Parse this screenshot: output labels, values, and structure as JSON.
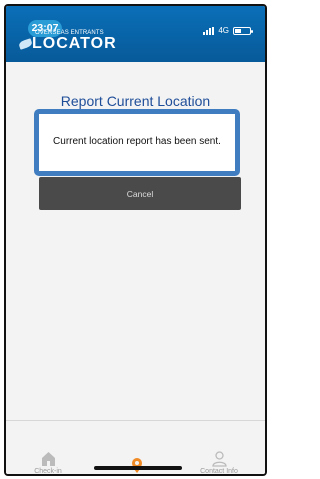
{
  "status_bar": {
    "time": "23:07",
    "network": "4G"
  },
  "app": {
    "logo_top": "OVERSEAS ENTRANTS",
    "logo_bottom": "LOCATOR"
  },
  "page": {
    "title": "Report Current Location"
  },
  "dialog": {
    "message": "Current location report has been sent.",
    "cancel_label": "Cancel"
  },
  "tabs": [
    {
      "label": "Check-in",
      "icon": "home-icon"
    },
    {
      "label": "",
      "icon": "location-pin-icon"
    },
    {
      "label": "Contact Info",
      "icon": "person-icon"
    }
  ],
  "colors": {
    "header_blue": "#075a99",
    "accent_orange": "#f08a24",
    "dialog_border": "#3f7dc0"
  }
}
